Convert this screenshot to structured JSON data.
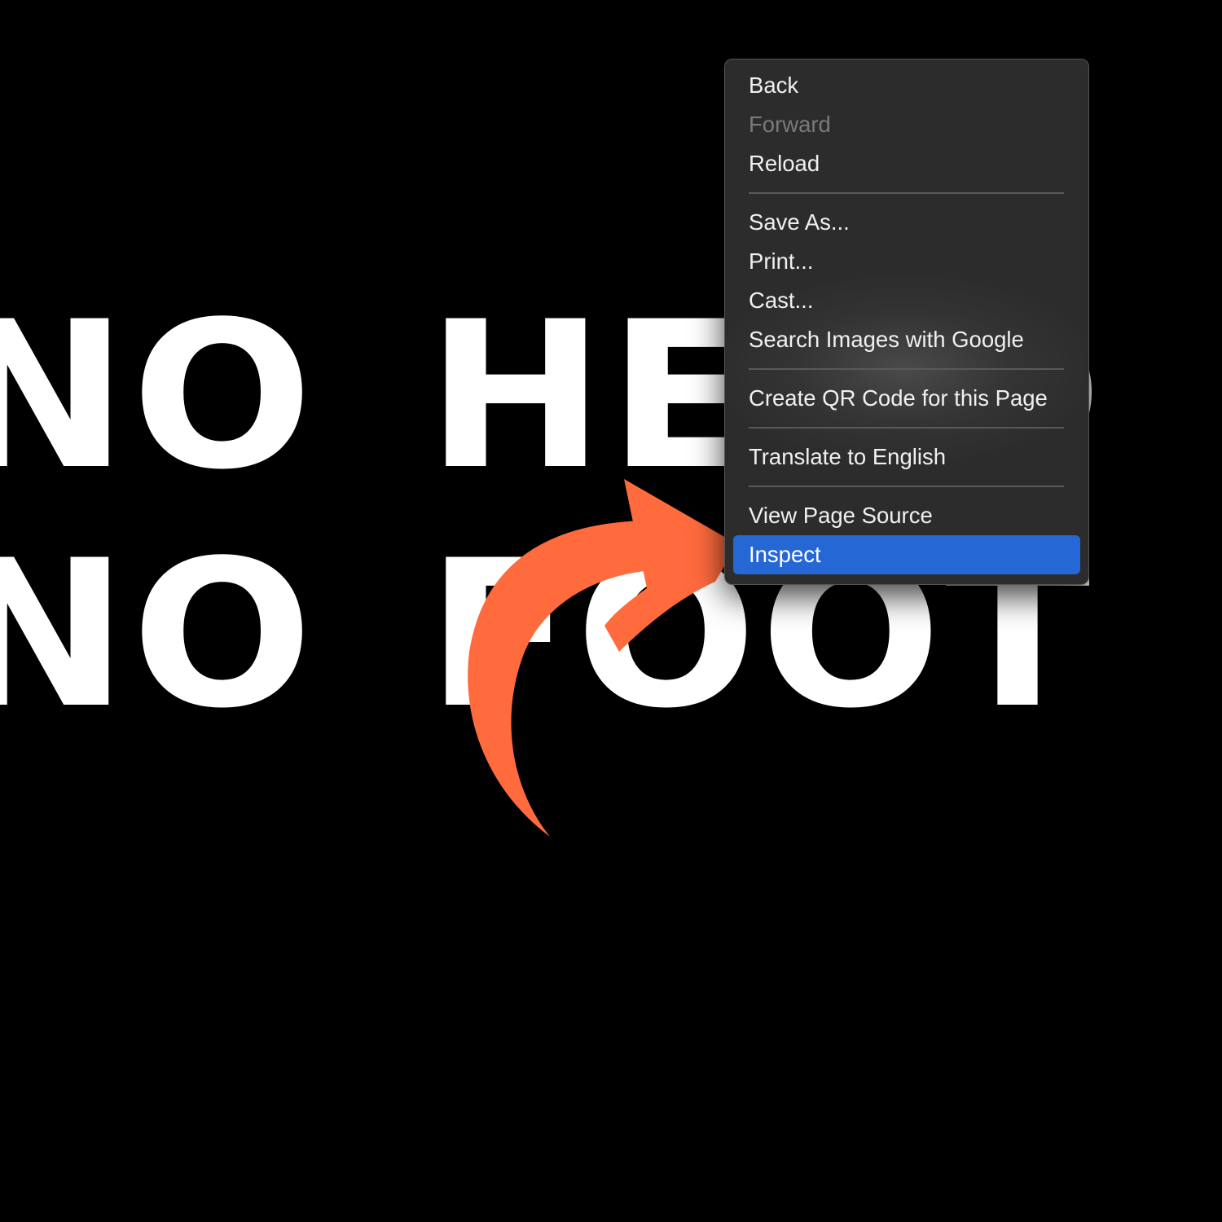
{
  "background": {
    "color": "#000000",
    "headline_lines": [
      "NO HEAD",
      "NO FOOT"
    ],
    "text_color": "#ffffff"
  },
  "context_menu": {
    "groups": [
      [
        {
          "label": "Back",
          "state": "enabled"
        },
        {
          "label": "Forward",
          "state": "disabled"
        },
        {
          "label": "Reload",
          "state": "enabled"
        }
      ],
      [
        {
          "label": "Save As...",
          "state": "enabled"
        },
        {
          "label": "Print...",
          "state": "enabled"
        },
        {
          "label": "Cast...",
          "state": "enabled"
        },
        {
          "label": "Search Images with Google",
          "state": "enabled"
        }
      ],
      [
        {
          "label": "Create QR Code for this Page",
          "state": "enabled"
        }
      ],
      [
        {
          "label": "Translate to English",
          "state": "enabled"
        }
      ],
      [
        {
          "label": "View Page Source",
          "state": "enabled"
        },
        {
          "label": "Inspect",
          "state": "selected"
        }
      ]
    ],
    "highlight_color": "#2667d6"
  },
  "annotation": {
    "icon": "curved-arrow-icon",
    "color": "#ff6b3d",
    "points_to": "Inspect"
  }
}
